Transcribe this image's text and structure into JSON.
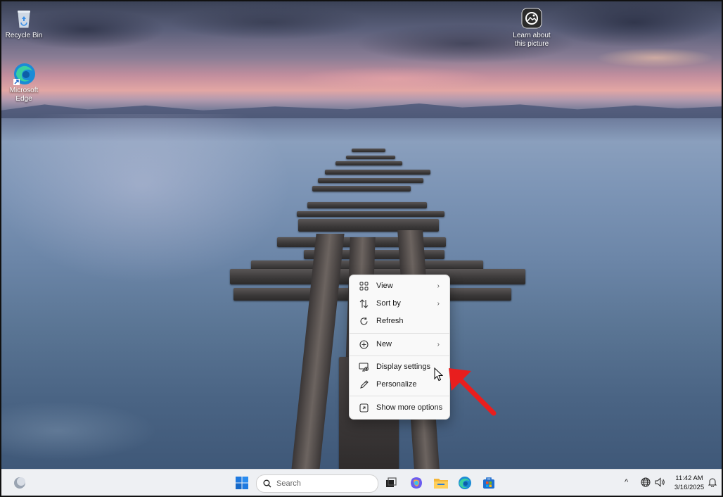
{
  "desktop": {
    "icons": [
      {
        "name": "Recycle Bin",
        "icon": "recycle-bin-icon"
      },
      {
        "name": "Microsoft\nEdge",
        "icon": "edge-icon"
      }
    ],
    "spotlight": {
      "label": "Learn about\nthis picture",
      "icon": "spotlight-icon"
    }
  },
  "context_menu": {
    "items": [
      {
        "label": "View",
        "icon": "grid-icon",
        "submenu": true
      },
      {
        "label": "Sort by",
        "icon": "sort-icon",
        "submenu": true
      },
      {
        "label": "Refresh",
        "icon": "refresh-icon",
        "submenu": false
      },
      {
        "label": "New",
        "icon": "plus-circle-icon",
        "submenu": true
      },
      {
        "label": "Display settings",
        "icon": "display-icon",
        "submenu": false
      },
      {
        "label": "Personalize",
        "icon": "pen-icon",
        "submenu": false
      },
      {
        "label": "Show more options",
        "icon": "expand-icon",
        "submenu": false
      }
    ],
    "chevron": "›"
  },
  "taskbar": {
    "search_placeholder": "Search",
    "apps": [
      "start-icon",
      "task-view-icon",
      "copilot-icon",
      "file-explorer-icon",
      "edge-icon",
      "store-icon"
    ],
    "tray": {
      "chevron": "^",
      "time": "11:42 AM",
      "date": "3/16/2025"
    }
  },
  "annotation": {
    "color": "#e81e1e"
  }
}
